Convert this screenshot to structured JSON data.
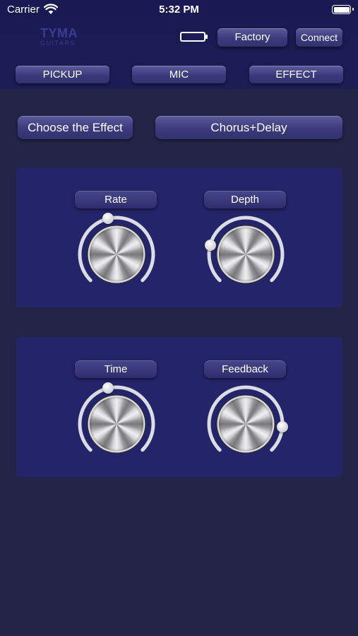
{
  "status_bar": {
    "carrier": "Carrier",
    "time": "5:32 PM"
  },
  "logo": {
    "main": "TYMA",
    "sub": "GUITARS"
  },
  "header": {
    "factory_label": "Factory",
    "connect_label": "Connect"
  },
  "tabs": [
    {
      "label": "PICKUP"
    },
    {
      "label": "MIC"
    },
    {
      "label": "EFFECT"
    }
  ],
  "effect": {
    "choose_label": "Choose the Effect",
    "selected": "Chorus+Delay"
  },
  "knobs": [
    {
      "label": "Rate",
      "level": 0.45
    },
    {
      "label": "Depth",
      "level": 0.22
    },
    {
      "label": "Time",
      "level": 0.45
    },
    {
      "label": "Feedback",
      "level": 0.85
    }
  ],
  "colors": {
    "background": "#242449",
    "header": "#1a1a52",
    "panel": "#24246a",
    "button": "#3a3a7c",
    "logo": "#3a3a98"
  }
}
